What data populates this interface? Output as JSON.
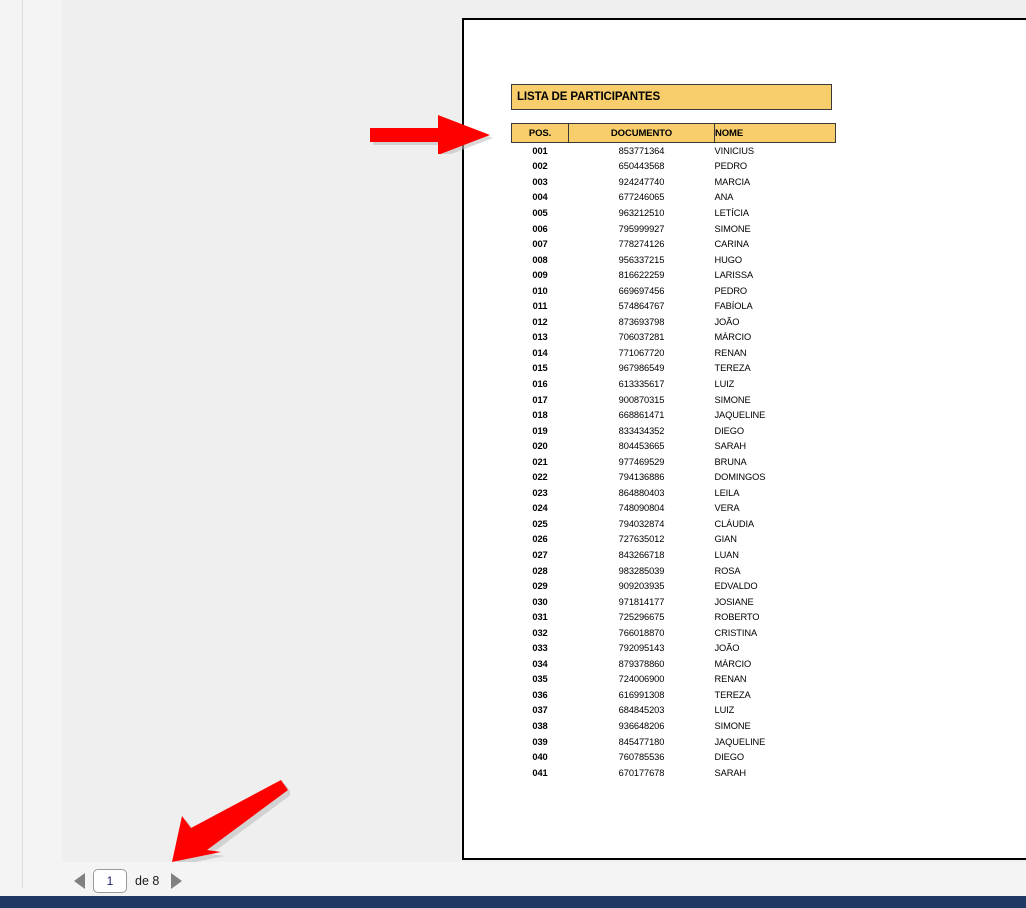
{
  "document": {
    "report_title": "LISTA DE PARTICIPANTES",
    "columns": {
      "pos": "POS.",
      "documento": "DOCUMENTO",
      "nome": "NOME"
    },
    "rows": [
      {
        "pos": "001",
        "documento": "853771364",
        "nome": "VINICIUS"
      },
      {
        "pos": "002",
        "documento": "650443568",
        "nome": "PEDRO"
      },
      {
        "pos": "003",
        "documento": "924247740",
        "nome": "MARCIA"
      },
      {
        "pos": "004",
        "documento": "677246065",
        "nome": "ANA"
      },
      {
        "pos": "005",
        "documento": "963212510",
        "nome": "LETÍCIA"
      },
      {
        "pos": "006",
        "documento": "795999927",
        "nome": "SIMONE"
      },
      {
        "pos": "007",
        "documento": "778274126",
        "nome": "CARINA"
      },
      {
        "pos": "008",
        "documento": "956337215",
        "nome": "HUGO"
      },
      {
        "pos": "009",
        "documento": "816622259",
        "nome": "LARISSA"
      },
      {
        "pos": "010",
        "documento": "669697456",
        "nome": "PEDRO"
      },
      {
        "pos": "011",
        "documento": "574864767",
        "nome": "FABÍOLA"
      },
      {
        "pos": "012",
        "documento": "873693798",
        "nome": "JOÃO"
      },
      {
        "pos": "013",
        "documento": "706037281",
        "nome": "MÁRCIO"
      },
      {
        "pos": "014",
        "documento": "771067720",
        "nome": "RENAN"
      },
      {
        "pos": "015",
        "documento": "967986549",
        "nome": "TEREZA"
      },
      {
        "pos": "016",
        "documento": "613335617",
        "nome": "LUIZ"
      },
      {
        "pos": "017",
        "documento": "900870315",
        "nome": "SIMONE"
      },
      {
        "pos": "018",
        "documento": "668861471",
        "nome": "JAQUELINE"
      },
      {
        "pos": "019",
        "documento": "833434352",
        "nome": "DIEGO"
      },
      {
        "pos": "020",
        "documento": "804453665",
        "nome": "SARAH"
      },
      {
        "pos": "021",
        "documento": "977469529",
        "nome": "BRUNA"
      },
      {
        "pos": "022",
        "documento": "794136886",
        "nome": "DOMINGOS"
      },
      {
        "pos": "023",
        "documento": "864880403",
        "nome": "LEILA"
      },
      {
        "pos": "024",
        "documento": "748090804",
        "nome": "VERA"
      },
      {
        "pos": "025",
        "documento": "794032874",
        "nome": "CLÁUDIA"
      },
      {
        "pos": "026",
        "documento": "727635012",
        "nome": "GIAN"
      },
      {
        "pos": "027",
        "documento": "843266718",
        "nome": "LUAN"
      },
      {
        "pos": "028",
        "documento": "983285039",
        "nome": "ROSA"
      },
      {
        "pos": "029",
        "documento": "909203935",
        "nome": "EDVALDO"
      },
      {
        "pos": "030",
        "documento": "971814177",
        "nome": "JOSIANE"
      },
      {
        "pos": "031",
        "documento": "725296675",
        "nome": "ROBERTO"
      },
      {
        "pos": "032",
        "documento": "766018870",
        "nome": "CRISTINA"
      },
      {
        "pos": "033",
        "documento": "792095143",
        "nome": "JOÃO"
      },
      {
        "pos": "034",
        "documento": "879378860",
        "nome": "MÁRCIO"
      },
      {
        "pos": "035",
        "documento": "724006900",
        "nome": "RENAN"
      },
      {
        "pos": "036",
        "documento": "616991308",
        "nome": "TEREZA"
      },
      {
        "pos": "037",
        "documento": "684845203",
        "nome": "LUIZ"
      },
      {
        "pos": "038",
        "documento": "936648206",
        "nome": "SIMONE"
      },
      {
        "pos": "039",
        "documento": "845477180",
        "nome": "JAQUELINE"
      },
      {
        "pos": "040",
        "documento": "760785536",
        "nome": "DIEGO"
      },
      {
        "pos": "041",
        "documento": "670177678",
        "nome": "SARAH"
      }
    ]
  },
  "pagination": {
    "prev_icon": "triangle-left-icon",
    "next_icon": "triangle-right-icon",
    "current_page": "1",
    "total_label": "de 8"
  },
  "annotations": [
    {
      "name": "arrow-to-header",
      "icon": "red-arrow-right-icon",
      "color": "#FF0000"
    },
    {
      "name": "arrow-to-pager",
      "icon": "red-arrow-down-left-icon",
      "color": "#FF0000"
    }
  ],
  "colors": {
    "header_fill": "#F7CE6B",
    "page_background": "#FFFFFF",
    "pane_background": "#EFEFEF",
    "status_bar": "#1F3864",
    "annotation_red": "#FF0000"
  }
}
